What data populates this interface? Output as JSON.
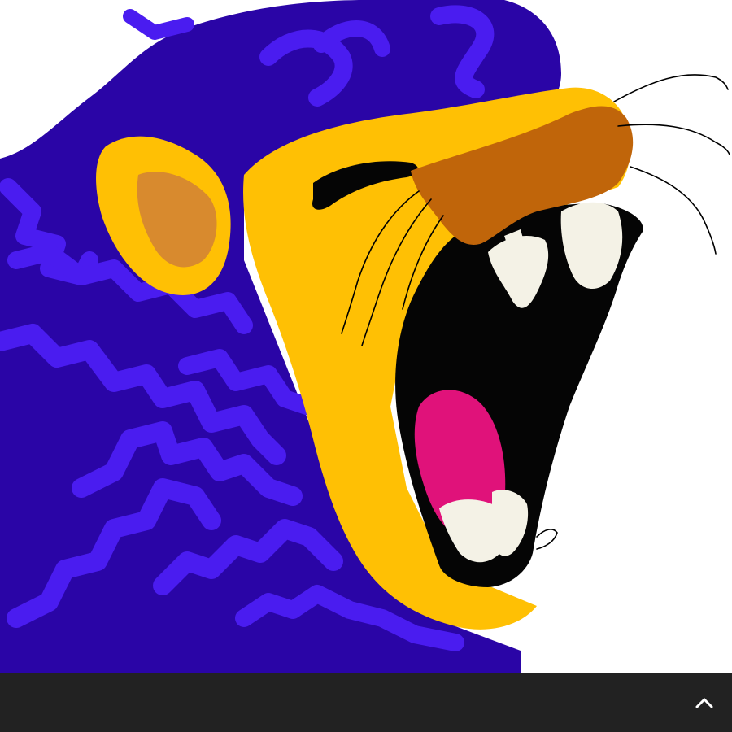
{
  "artwork": {
    "subject_icon": "roaring-lion-painting",
    "colors": {
      "background": "#ffffff",
      "mane": "#2a05a6",
      "mane_stripes": "#4a1cf0",
      "face": "#ffc004",
      "ear_inner": "#d88a2e",
      "nose": "#c0650a",
      "mouth": "#050505",
      "tongue": "#e0127a",
      "teeth": "#f4f2e6",
      "whiskers": "#000000"
    }
  },
  "bottom_bar": {
    "background": "#222222",
    "icon": "chevron-up-icon",
    "icon_color": "#ffffff"
  }
}
